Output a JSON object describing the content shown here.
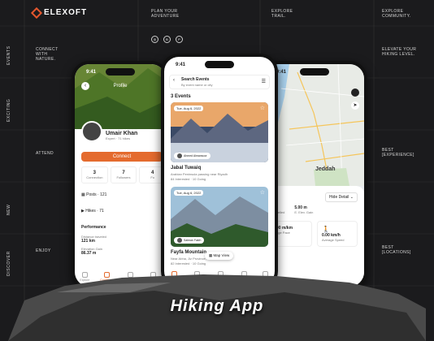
{
  "brand": {
    "name": "ELEXOFT"
  },
  "top": [
    "PLAN YOUR ADVENTURE",
    "EXPLORE TRAIL.",
    "EXPLORE COMMUNITY."
  ],
  "left_vertical": [
    "EVENTS",
    "EXCITING",
    "NEW",
    "DISCOVER"
  ],
  "left_side": [
    "CONNECT WITH NATURE.",
    "ATTEND",
    "ENJOY"
  ],
  "right_side": [
    "ELEVATE YOUR HIKING LEVEL.",
    "BEST [EXPERIENCE]",
    "BEST [LOCATIONS]"
  ],
  "social_icons": [
    "dribbble-icon",
    "behance-icon",
    "pinterest-icon"
  ],
  "title": "Hiking App",
  "profile": {
    "time": "9:41",
    "header": "Profile",
    "name": "Umair Khan",
    "level": "Expert",
    "hikes": "71 hikes",
    "connect": "Connect",
    "stats": [
      {
        "v": "3",
        "l": "Connection"
      },
      {
        "v": "7",
        "l": "Followers"
      },
      {
        "v": "4",
        "l": "Fo"
      }
    ],
    "posts": "Posts",
    "posts_count": "121",
    "hikes_label": "Hikes",
    "hikes_count": "71",
    "performance": "Performance",
    "distance_label": "Distance traveled",
    "distance": "121 km",
    "elev_label": "Elevation Gain",
    "elev": "86.37 m",
    "nav": [
      "Explore",
      "Community",
      "Navigate",
      "Notification"
    ]
  },
  "events": {
    "time": "9:41",
    "search_title": "Search Events",
    "search_ph": "By event name or city",
    "count": "3 Events",
    "e1": {
      "date": "Tue, Aug 6, 2022",
      "host": "Ahmed Almansoor",
      "host_sub": "★ 4.8 (32)",
      "name": "Jabal Tuwaiq",
      "desc": "Arabian Peninsula passing near Riyadh",
      "meta": "84 Interested · 10 Going"
    },
    "e2": {
      "date": "Tue, Aug 6, 2022",
      "host": "Salman Fakih",
      "host_sub": "★ 4.8 (32)",
      "name": "Fayfa Mountain",
      "desc": "Near Abha, Jiz Province,",
      "meta": "82 Interested · 10 Going"
    },
    "map_view": "Map View",
    "nav": [
      "Explore",
      "Community",
      "Navigate",
      "Notification",
      "Menu"
    ]
  },
  "map": {
    "time": "9:41",
    "city": "Jeddah",
    "dist": "0",
    "elev": "5.00 m",
    "dist_label": "Travelled",
    "elev_label": "E. Elev. Gain",
    "hide": "Hide Detail",
    "pace": "00 m/km",
    "pace_label": "age Pace",
    "speed": "0.00 km/h",
    "speed_label": "Average Speed"
  }
}
